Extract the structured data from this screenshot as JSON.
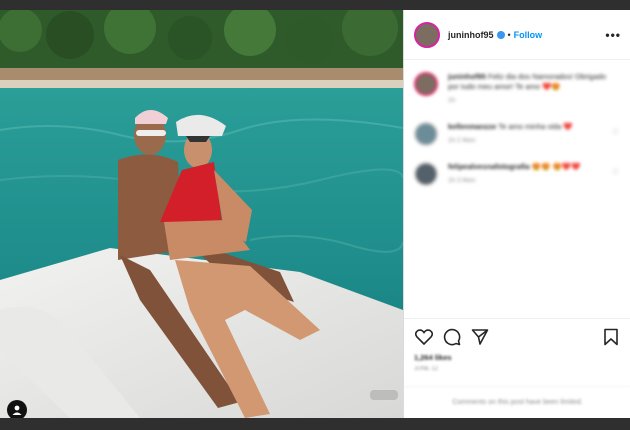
{
  "post": {
    "author": "juninhof95",
    "follow_label": "Follow",
    "dot": "•",
    "more_label": "•••"
  },
  "comments": [
    {
      "user": "juninhof95",
      "text": "Feliz dia dos Namorados! Obrigado por tudo meu amor! Te amo ❤️😍",
      "meta": "1h"
    },
    {
      "user": "kellenmanzze",
      "text": "Te amo minha vida ❤️",
      "meta": "1h   2 likes"
    },
    {
      "user": "felipealvesnafotografia",
      "text": "😍😍 😍❤️❤️",
      "meta": "1h   3 likes"
    }
  ],
  "footer": {
    "likes": "1,264 likes",
    "date": "JUNE 12",
    "disabled_notice": "Comments on this post have been limited."
  },
  "colors": {
    "accent": "#0095f6",
    "verified": "#3897f0",
    "heart": "#ed4956"
  },
  "icons": [
    "heart-icon",
    "comment-icon",
    "share-icon",
    "bookmark-icon",
    "user-tag-icon",
    "more-icon"
  ]
}
